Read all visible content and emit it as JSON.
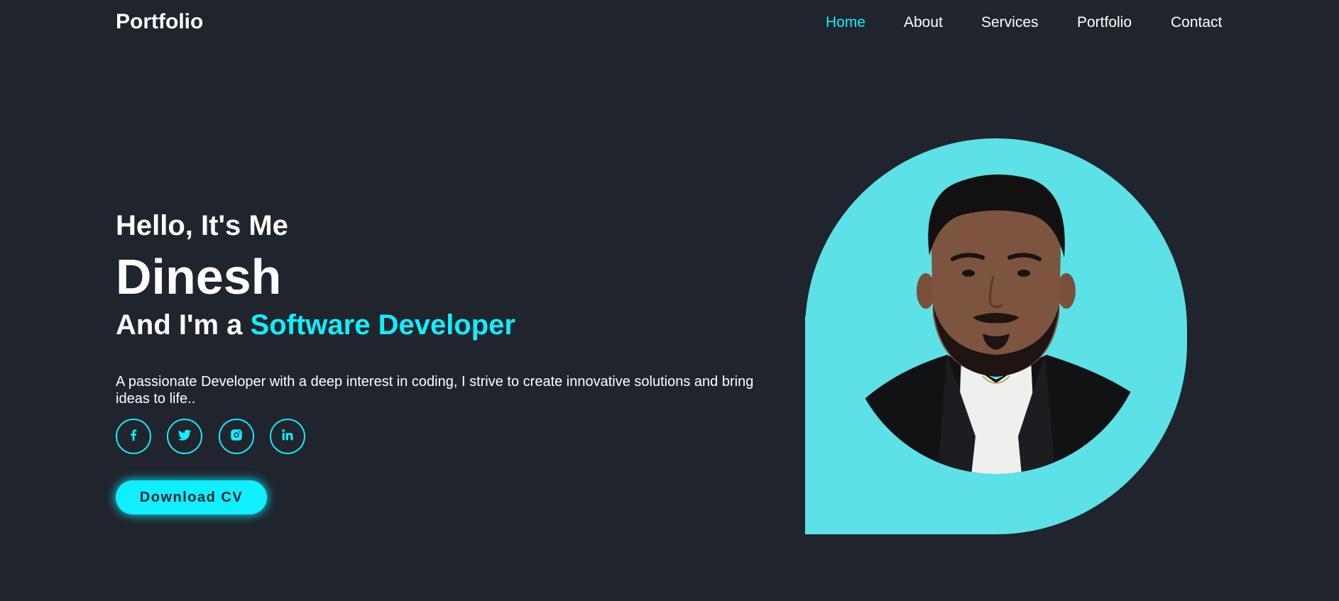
{
  "header": {
    "logo": "Portfolio",
    "nav": [
      {
        "label": "Home",
        "active": true
      },
      {
        "label": "About",
        "active": false
      },
      {
        "label": "Services",
        "active": false
      },
      {
        "label": "Portfolio",
        "active": false
      },
      {
        "label": "Contact",
        "active": false
      }
    ]
  },
  "hero": {
    "greeting": "Hello, It's Me",
    "name": "Dinesh",
    "role_prefix": "And I'm a ",
    "role_highlight": "Software Developer",
    "description": "A passionate Developer with a deep interest in coding, I strive to create innovative solutions and bring ideas to life..",
    "socials": [
      {
        "icon": "facebook-icon"
      },
      {
        "icon": "twitter-icon"
      },
      {
        "icon": "instagram-icon"
      },
      {
        "icon": "linkedin-icon"
      }
    ],
    "cta_label": "Download CV"
  },
  "colors": {
    "background": "#1f242d",
    "accent": "#0ef0ff",
    "photo_bg": "#5ce1e6",
    "text": "#ffffff"
  }
}
